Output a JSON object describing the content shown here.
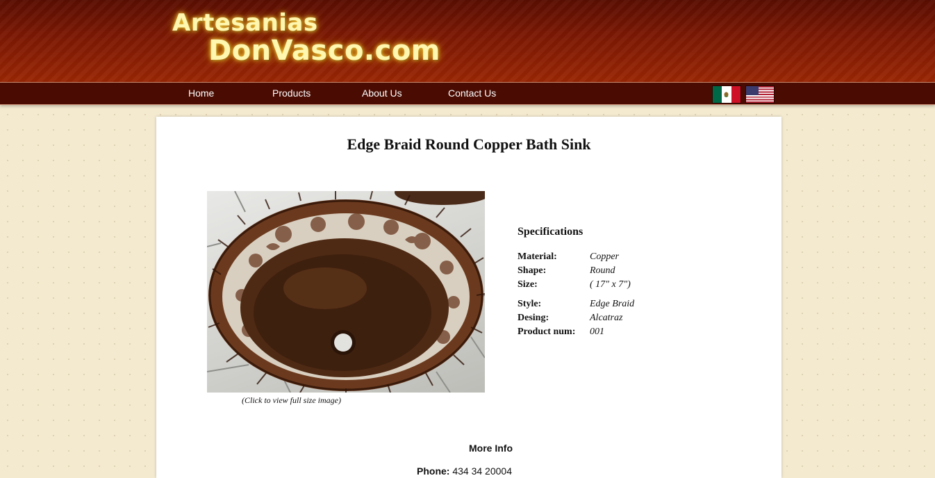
{
  "brand": {
    "line1": "Artesanias",
    "line2": "DonVasco.com"
  },
  "nav": {
    "items": [
      {
        "label": "Home"
      },
      {
        "label": "Products"
      },
      {
        "label": "About Us"
      },
      {
        "label": "Contact Us"
      }
    ]
  },
  "languages": [
    "mexico-flag-icon",
    "usa-flag-icon"
  ],
  "product": {
    "title": "Edge Braid Round Copper Bath Sink",
    "image_caption": "(Click to view full size image)",
    "specs_title": "Specifications",
    "specs": [
      {
        "label": "Material:",
        "value": "Copper"
      },
      {
        "label": "Shape:",
        "value": "Round"
      },
      {
        "label": "Size:",
        "value": "( 17\" x 7\")"
      },
      {
        "label": "Style:",
        "value": "Edge Braid"
      },
      {
        "label": "Desing:",
        "value": "Alcatraz"
      },
      {
        "label": "Product num:",
        "value": "001"
      }
    ]
  },
  "more_info": {
    "title": "More Info",
    "phone_label": "Phone:",
    "phone_value": "434 34 20004"
  },
  "colors": {
    "header": "#8a1e04",
    "navbar": "#4a0c02",
    "page_bg": "#f4ead0",
    "logo_text": "#fff7b0"
  }
}
